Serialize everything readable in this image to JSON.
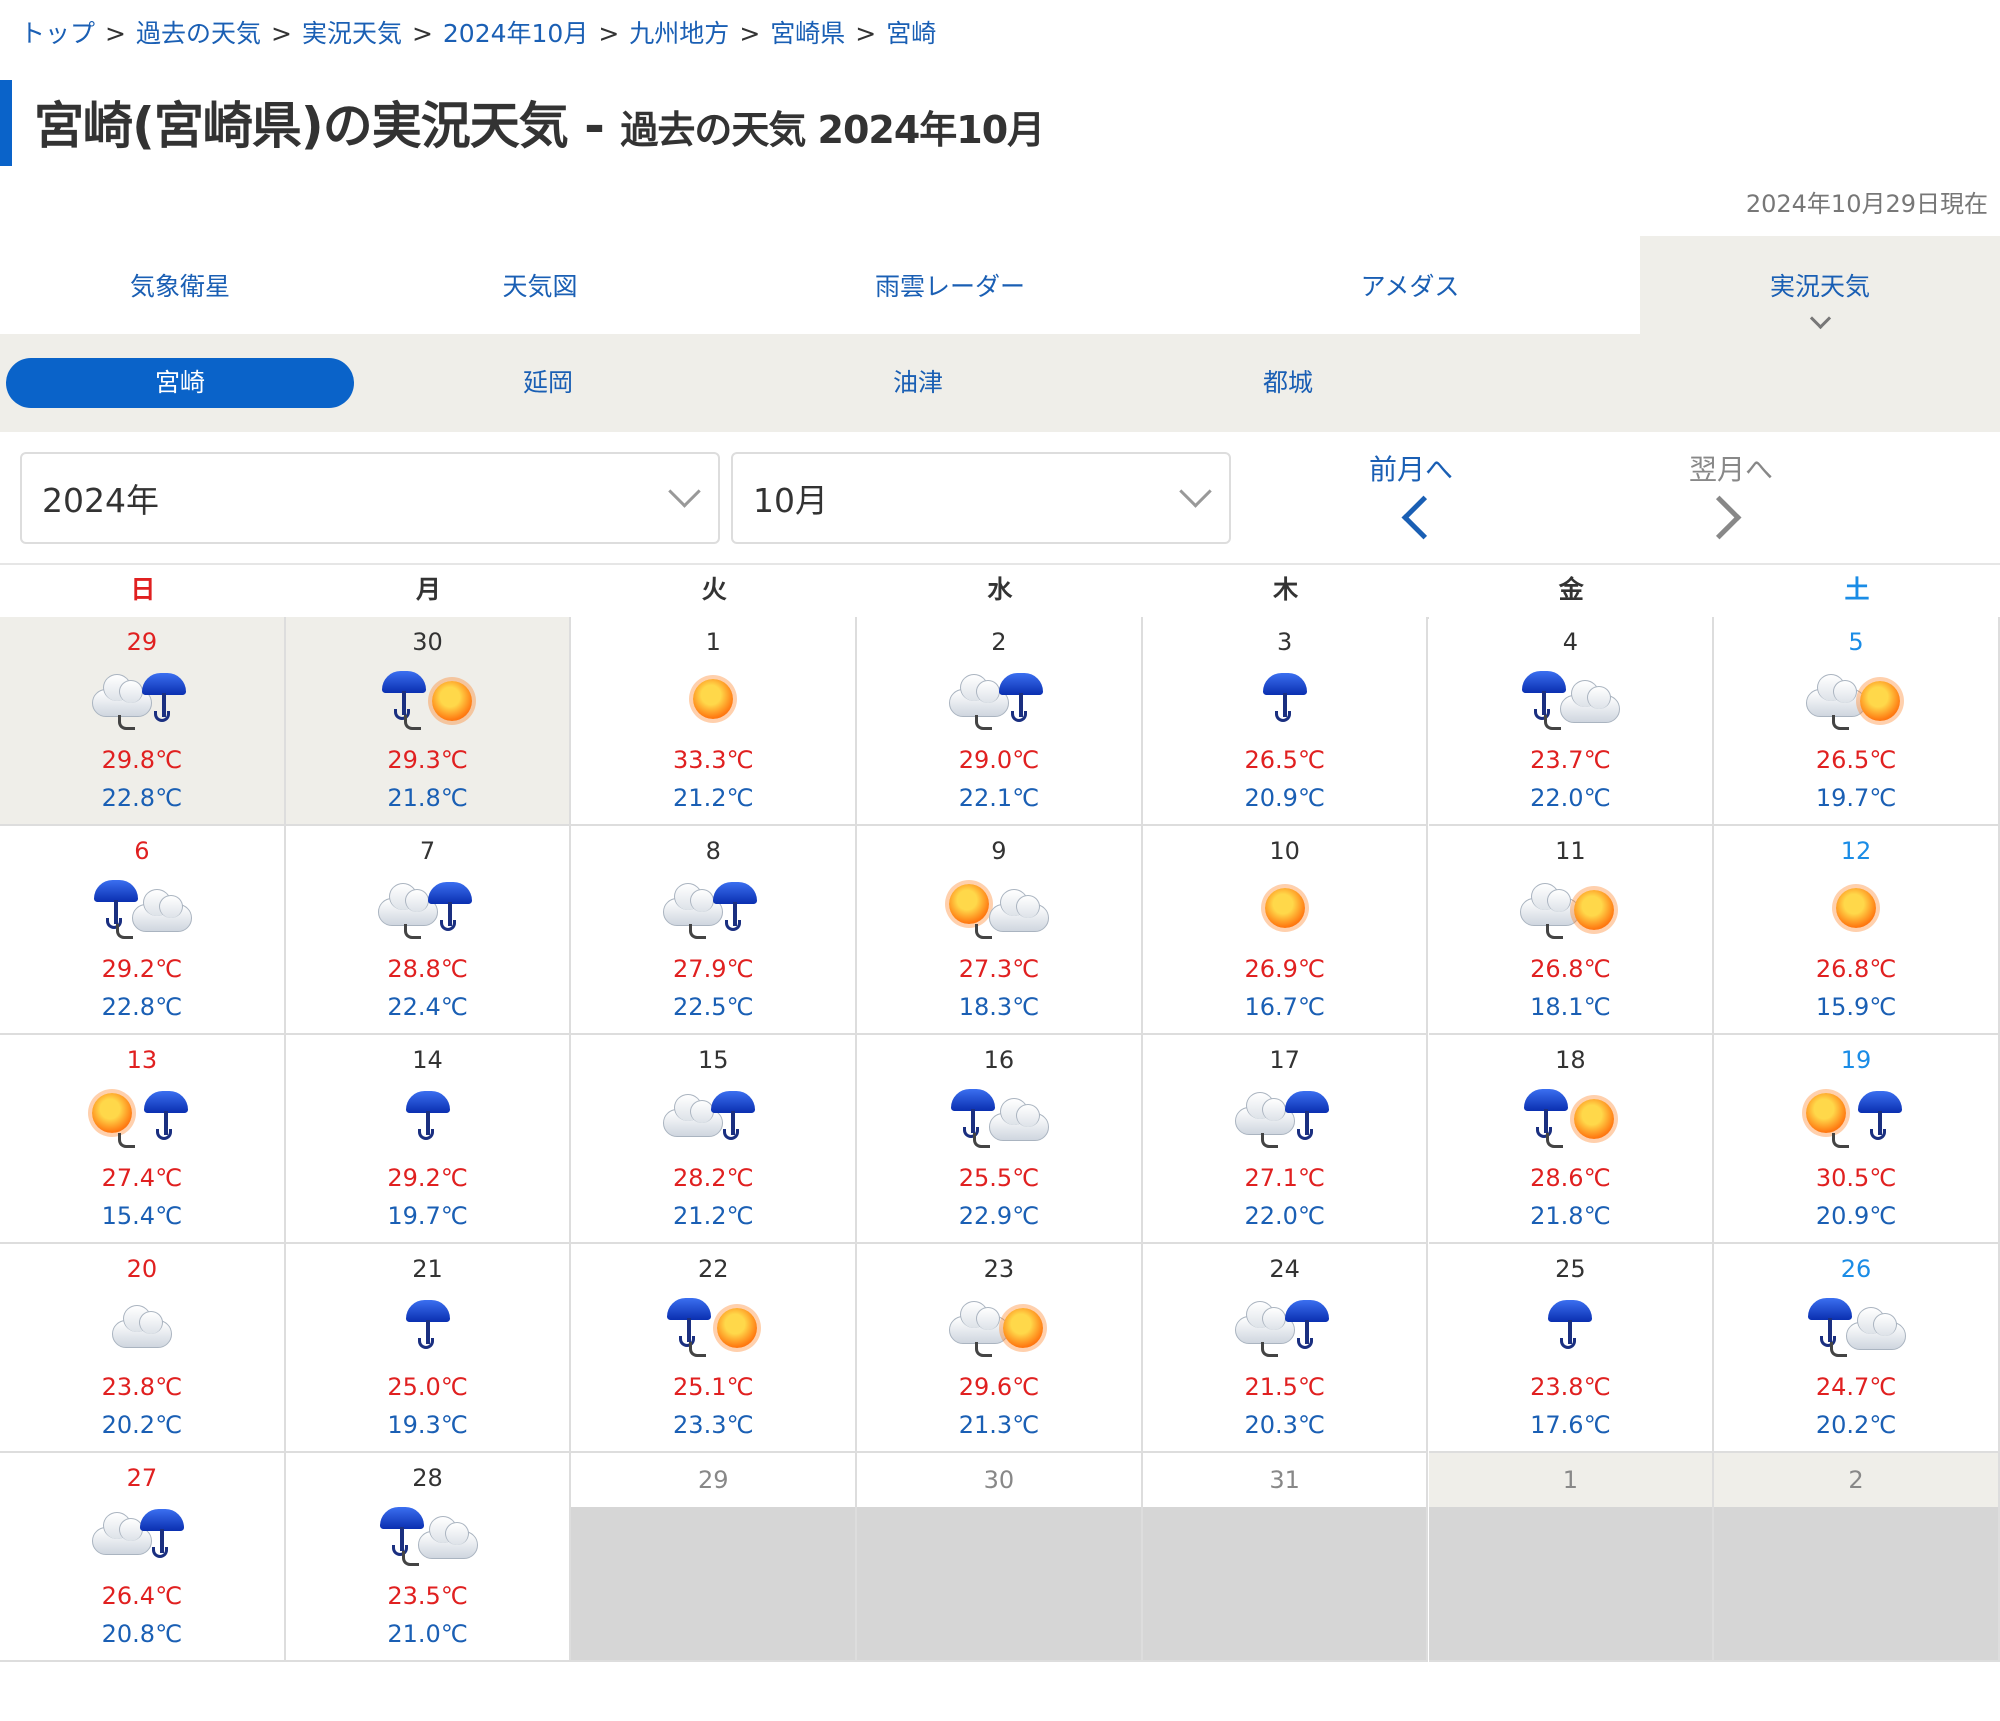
{
  "breadcrumb": [
    "トップ",
    "過去の天気",
    "実況天気",
    "2024年10月",
    "九州地方",
    "宮崎県",
    "宮崎"
  ],
  "title": {
    "main": "宮崎(宮崎県)の実況天気",
    "dash": "-",
    "sub": "過去の天気 2024年10月"
  },
  "as_of": "2024年10月29日現在",
  "main_tabs": [
    "気象衛星",
    "天気図",
    "雨雲レーダー",
    "アメダス",
    "実況天気"
  ],
  "sub_tabs": [
    "宮崎",
    "延岡",
    "油津",
    "都城"
  ],
  "year_select": "2024年",
  "month_select": "10月",
  "nav": {
    "prev": "前月へ",
    "next": "翌月へ"
  },
  "weekdays": [
    "日",
    "月",
    "火",
    "水",
    "木",
    "金",
    "土"
  ],
  "colors": {
    "accent": "#0a63c9",
    "high": "#e02020",
    "low": "#1a5fb4",
    "saturday": "#1a8ce6"
  },
  "days": [
    {
      "day": "29",
      "icon": "cloud-then-rain",
      "hi": "29.8℃",
      "lo": "22.8℃",
      "prev": true
    },
    {
      "day": "30",
      "icon": "rain-then-sun",
      "hi": "29.3℃",
      "lo": "21.8℃",
      "prev": true
    },
    {
      "day": "1",
      "icon": "sun",
      "hi": "33.3℃",
      "lo": "21.2℃"
    },
    {
      "day": "2",
      "icon": "cloud-then-rain",
      "hi": "29.0℃",
      "lo": "22.1℃"
    },
    {
      "day": "3",
      "icon": "rain",
      "hi": "26.5℃",
      "lo": "20.9℃"
    },
    {
      "day": "4",
      "icon": "rain-then-cloud",
      "hi": "23.7℃",
      "lo": "22.0℃"
    },
    {
      "day": "5",
      "icon": "cloud-then-sun",
      "hi": "26.5℃",
      "lo": "19.7℃"
    },
    {
      "day": "6",
      "icon": "rain-then-cloud",
      "hi": "29.2℃",
      "lo": "22.8℃"
    },
    {
      "day": "7",
      "icon": "cloud-then-rain",
      "hi": "28.8℃",
      "lo": "22.4℃"
    },
    {
      "day": "8",
      "icon": "cloud-then-rain",
      "hi": "27.9℃",
      "lo": "22.5℃"
    },
    {
      "day": "9",
      "icon": "sun-then-cloud",
      "hi": "27.3℃",
      "lo": "18.3℃"
    },
    {
      "day": "10",
      "icon": "sun",
      "hi": "26.9℃",
      "lo": "16.7℃"
    },
    {
      "day": "11",
      "icon": "cloud-then-sun",
      "hi": "26.8℃",
      "lo": "18.1℃"
    },
    {
      "day": "12",
      "icon": "sun",
      "hi": "26.8℃",
      "lo": "15.9℃"
    },
    {
      "day": "13",
      "icon": "sun-then-rain",
      "hi": "27.4℃",
      "lo": "15.4℃"
    },
    {
      "day": "14",
      "icon": "rain",
      "hi": "29.2℃",
      "lo": "19.7℃"
    },
    {
      "day": "15",
      "icon": "cloud-with-rain",
      "hi": "28.2℃",
      "lo": "21.2℃"
    },
    {
      "day": "16",
      "icon": "rain-then-cloud",
      "hi": "25.5℃",
      "lo": "22.9℃"
    },
    {
      "day": "17",
      "icon": "cloud-then-rain",
      "hi": "27.1℃",
      "lo": "22.0℃"
    },
    {
      "day": "18",
      "icon": "rain-then-sun",
      "hi": "28.6℃",
      "lo": "21.8℃"
    },
    {
      "day": "19",
      "icon": "sun-then-rain",
      "hi": "30.5℃",
      "lo": "20.9℃"
    },
    {
      "day": "20",
      "icon": "cloud",
      "hi": "23.8℃",
      "lo": "20.2℃"
    },
    {
      "day": "21",
      "icon": "rain",
      "hi": "25.0℃",
      "lo": "19.3℃"
    },
    {
      "day": "22",
      "icon": "rain-then-sun",
      "hi": "25.1℃",
      "lo": "23.3℃"
    },
    {
      "day": "23",
      "icon": "cloud-then-sun",
      "hi": "29.6℃",
      "lo": "21.3℃"
    },
    {
      "day": "24",
      "icon": "cloud-then-rain",
      "hi": "21.5℃",
      "lo": "20.3℃"
    },
    {
      "day": "25",
      "icon": "rain",
      "hi": "23.8℃",
      "lo": "17.6℃"
    },
    {
      "day": "26",
      "icon": "rain-then-cloud",
      "hi": "24.7℃",
      "lo": "20.2℃"
    },
    {
      "day": "27",
      "icon": "cloud-with-rain",
      "hi": "26.4℃",
      "lo": "20.8℃"
    },
    {
      "day": "28",
      "icon": "rain-then-cloud",
      "hi": "23.5℃",
      "lo": "21.0℃"
    },
    {
      "day": "29",
      "empty": true
    },
    {
      "day": "30",
      "empty": true
    },
    {
      "day": "31",
      "empty": true
    },
    {
      "day": "1",
      "empty": true,
      "next": true
    },
    {
      "day": "2",
      "empty": true,
      "next": true
    }
  ]
}
